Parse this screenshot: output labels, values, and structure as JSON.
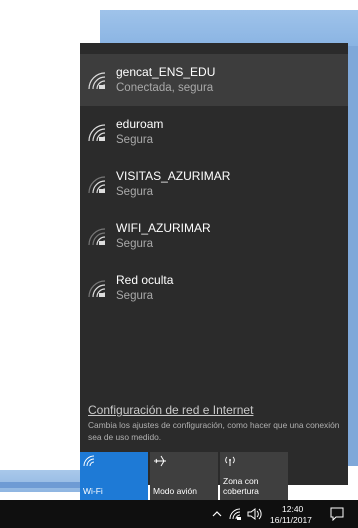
{
  "networks": [
    {
      "name": "gencat_ENS_EDU",
      "status": "Conectada, segura",
      "icon": "wifi-secure-icon",
      "selected": true
    },
    {
      "name": "eduroam",
      "status": "Segura",
      "icon": "wifi-secure-icon"
    },
    {
      "name": "VISITAS_AZURIMAR",
      "status": "Segura",
      "icon": "wifi-secure-icon"
    },
    {
      "name": "WIFI_AZURIMAR",
      "status": "Segura",
      "icon": "wifi-secure-icon"
    },
    {
      "name": "Red oculta",
      "status": "Segura",
      "icon": "wifi-secure-icon"
    }
  ],
  "settings": {
    "link": "Configuración de red e Internet",
    "description": "Cambia los ajustes de configuración, como hacer que una conexión sea de uso medido."
  },
  "quick_actions": [
    {
      "label": "Wi-Fi",
      "icon": "wifi-icon",
      "active": true
    },
    {
      "label": "Modo avión",
      "icon": "airplane-icon",
      "active": false
    },
    {
      "label": "Zona con cobertura",
      "icon": "mobile-hotspot-icon",
      "active": false
    }
  ],
  "colors": {
    "flyout_bg": "#2b2b2b",
    "selected_bg": "#3d3d3d",
    "accent": "#1e7ad6",
    "taskbar": "#0f0f0f"
  },
  "taskbar": {
    "time": "12:40",
    "date": "16/11/2017",
    "icons": [
      "chevron-up-icon",
      "wifi-icon",
      "speaker-icon",
      "notification-icon"
    ]
  }
}
